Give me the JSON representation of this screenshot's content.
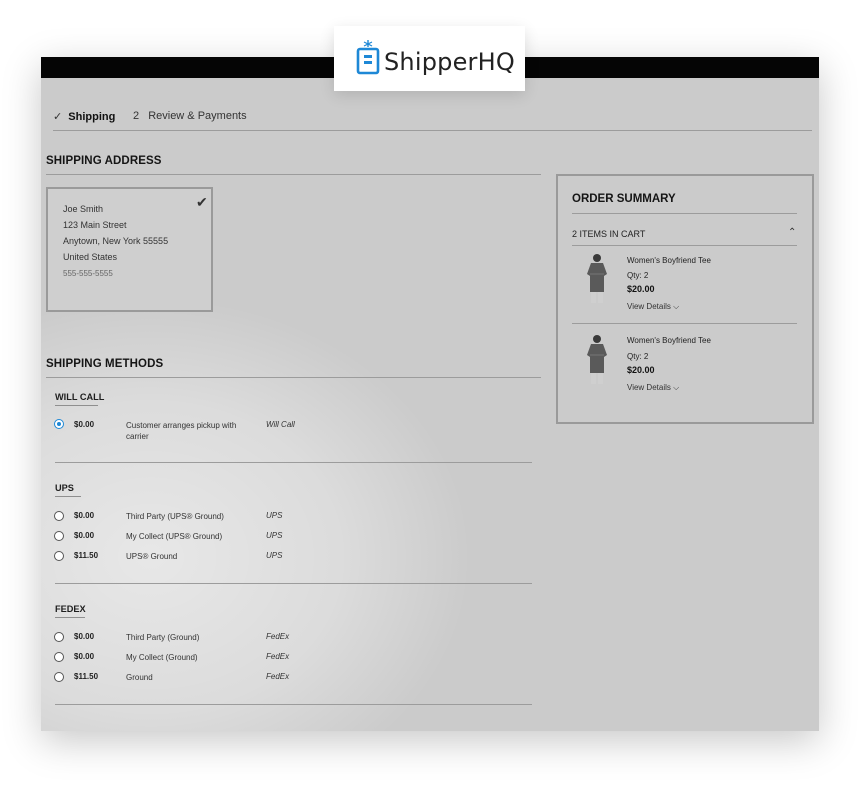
{
  "brand": {
    "name": "ShipperHQ",
    "accent": "#1e88d6",
    "icon": "shipping-box-icon"
  },
  "steps": [
    {
      "check": "✓",
      "label": "Shipping"
    },
    {
      "number": "2",
      "label": "Review & Payments"
    }
  ],
  "shipping_address": {
    "title": "SHIPPING ADDRESS",
    "name": "Joe Smith",
    "street": "123 Main Street",
    "city_line": "Anytown, New York 55555",
    "country": "United States",
    "phone": "555-555-5555",
    "selected_mark": "✔"
  },
  "shipping_methods": {
    "title": "SHIPPING METHODS",
    "groups": [
      {
        "carrier": "WILL CALL",
        "rates": [
          {
            "price": "$0.00",
            "method": "Customer arranges pickup with carrier",
            "carrier": "Will Call",
            "selected": true
          }
        ]
      },
      {
        "carrier": "UPS",
        "rates": [
          {
            "price": "$0.00",
            "method": "Third Party (UPS® Ground)",
            "carrier": "UPS",
            "selected": false
          },
          {
            "price": "$0.00",
            "method": "My Collect (UPS® Ground)",
            "carrier": "UPS",
            "selected": false
          },
          {
            "price": "$11.50",
            "method": "UPS® Ground",
            "carrier": "UPS",
            "selected": false
          }
        ]
      },
      {
        "carrier": "FEDEX",
        "rates": [
          {
            "price": "$0.00",
            "method": "Third Party (Ground)",
            "carrier": "FedEx",
            "selected": false
          },
          {
            "price": "$0.00",
            "method": "My Collect (Ground)",
            "carrier": "FedEx",
            "selected": false
          },
          {
            "price": "$11.50",
            "method": "Ground",
            "carrier": "FedEx",
            "selected": false
          }
        ]
      }
    ]
  },
  "order_summary": {
    "title": "ORDER SUMMARY",
    "items_in_cart": "2 ITEMS IN CART",
    "toggle": "⌃",
    "items": [
      {
        "name": "Women's Boyfriend Tee",
        "qty": "Qty: 2",
        "price": "$20.00",
        "details": "View Details ⌵"
      },
      {
        "name": "Women's Boyfriend Tee",
        "qty": "Qty: 2",
        "price": "$20.00",
        "details": "View Details ⌵"
      }
    ]
  }
}
